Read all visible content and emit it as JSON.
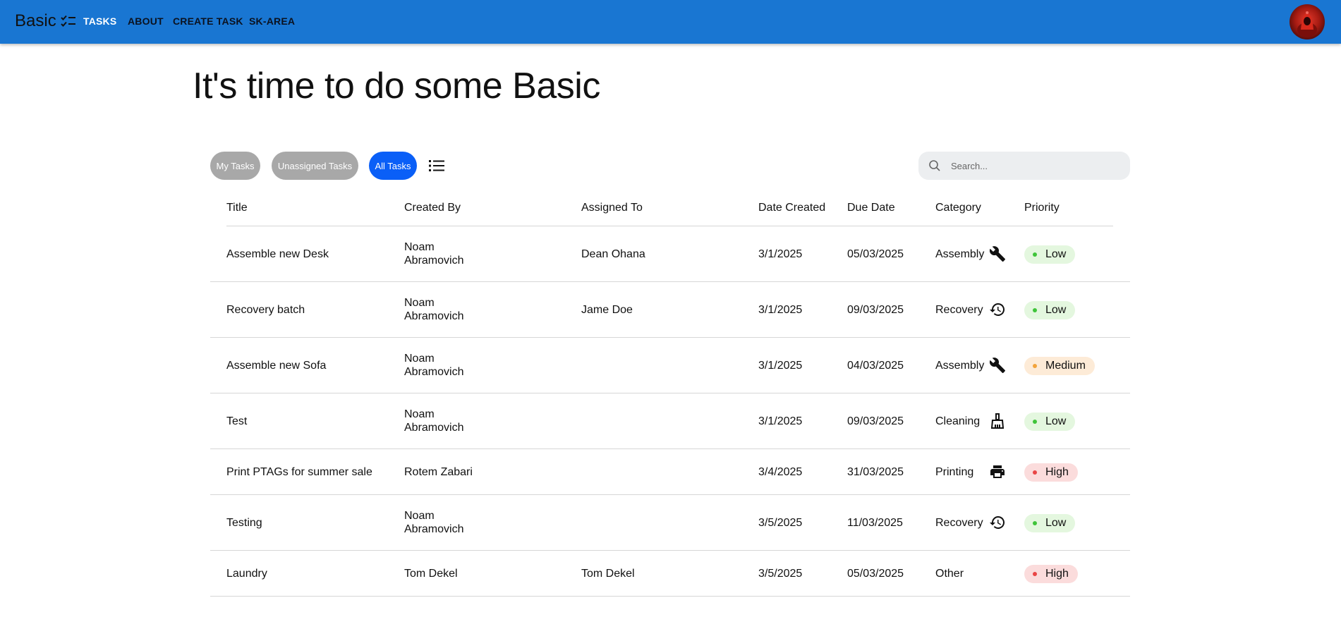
{
  "appbar": {
    "brand": "Basic",
    "nav": [
      {
        "label": "TASKS",
        "active": true
      },
      {
        "label": "ABOUT",
        "active": false
      },
      {
        "label": "CREATE TASK",
        "active": false
      },
      {
        "label": "SK-AREA",
        "active": false
      }
    ],
    "color": "#1976d2"
  },
  "hero": {
    "title": "It's time to do some Basic"
  },
  "filters": [
    {
      "label": "My Tasks",
      "active": false
    },
    {
      "label": "Unassigned Tasks",
      "active": false
    },
    {
      "label": "All Tasks",
      "active": true
    }
  ],
  "search": {
    "placeholder": "Search...",
    "value": ""
  },
  "table": {
    "headers": [
      "Title",
      "Created By",
      "Assigned To",
      "Date Created",
      "Due Date",
      "Category",
      "Priority"
    ],
    "rows": [
      {
        "title": "Assemble new Desk",
        "created_by": "Noam Abramovich",
        "assigned_to": "Dean Ohana",
        "date_created": "3/1/2025",
        "due_date": "05/03/2025",
        "category": "Assembly",
        "category_icon": "wrench-icon",
        "priority": "Low"
      },
      {
        "title": "Recovery batch",
        "created_by": "Noam Abramovich",
        "assigned_to": "Jame Doe",
        "date_created": "3/1/2025",
        "due_date": "09/03/2025",
        "category": "Recovery",
        "category_icon": "history-icon",
        "priority": "Low"
      },
      {
        "title": "Assemble new Sofa",
        "created_by": "Noam Abramovich",
        "assigned_to": "",
        "date_created": "3/1/2025",
        "due_date": "04/03/2025",
        "category": "Assembly",
        "category_icon": "wrench-icon",
        "priority": "Medium"
      },
      {
        "title": "Test",
        "created_by": "Noam Abramovich",
        "assigned_to": "",
        "date_created": "3/1/2025",
        "due_date": "09/03/2025",
        "category": "Cleaning",
        "category_icon": "broom-icon",
        "priority": "Low"
      },
      {
        "title": "Print PTAGs for summer sale",
        "created_by": "Rotem Zabari",
        "assigned_to": "",
        "date_created": "3/4/2025",
        "due_date": "31/03/2025",
        "category": "Printing",
        "category_icon": "printer-icon",
        "priority": "High"
      },
      {
        "title": "Testing",
        "created_by": "Noam Abramovich",
        "assigned_to": "",
        "date_created": "3/5/2025",
        "due_date": "11/03/2025",
        "category": "Recovery",
        "category_icon": "history-icon",
        "priority": "Low"
      },
      {
        "title": "Laundry",
        "created_by": "Tom Dekel",
        "assigned_to": "Tom Dekel",
        "date_created": "3/5/2025",
        "due_date": "05/03/2025",
        "category": "Other",
        "category_icon": "",
        "priority": "High"
      }
    ]
  },
  "priority_colors": {
    "Low": "#3fc43a",
    "Medium": "#f2a33a",
    "High": "#e94545"
  }
}
